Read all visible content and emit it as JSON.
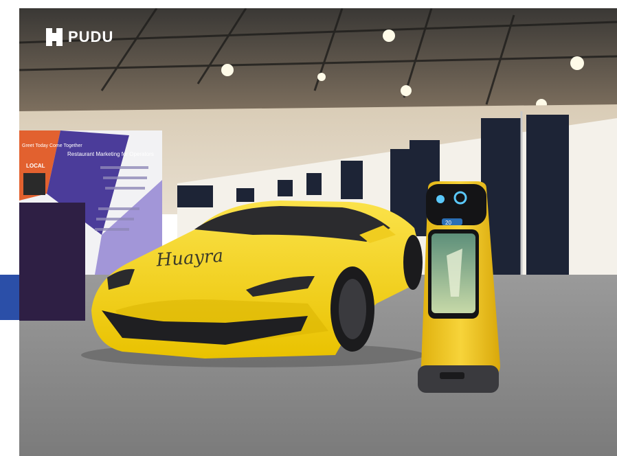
{
  "logo": {
    "text": "PUDU",
    "mark_icon": "pudu-logo-icon"
  },
  "scene": {
    "car_decal": "Huayra",
    "robot_display_number": "20",
    "banner_heading": "Restaurant Marketing for Operators",
    "banner_side_text": "Greet Today Come Together",
    "banner_badge": "LOCAL"
  },
  "colors": {
    "accent": "#2b4fa8",
    "car": "#f5d21a",
    "robot": "#f3c81b",
    "drape": "#1d2436"
  }
}
